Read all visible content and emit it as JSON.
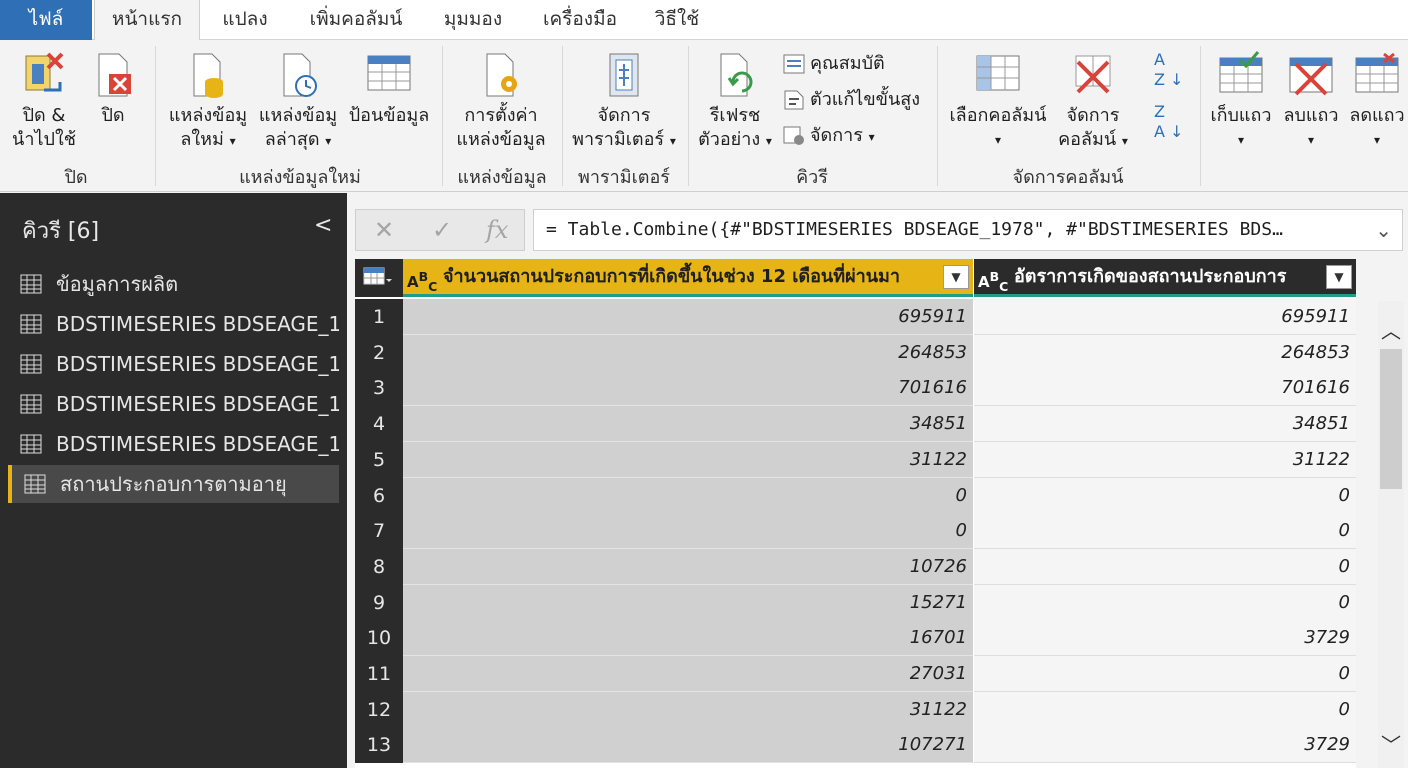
{
  "tabs": [
    "ไฟล์",
    "หน้าแรก",
    "แปลง",
    "เพิ่มคอลัมน์",
    "มุมมอง",
    "เครื่องมือ",
    "วิธีใช้"
  ],
  "ribbon": {
    "close_apply_1": "ปิด &",
    "close_apply_2": "นำไปใช้",
    "close": "ปิด",
    "group_close": "ปิด",
    "new_source_1": "แหล่งข้อมู",
    "new_source_2": "ลใหม่",
    "recent_source_1": "แหล่งข้อมู",
    "recent_source_2": "ลล่าสุด",
    "enter_data": "ป้อนข้อมูล",
    "group_new_query": "แหล่งข้อมูลใหม่",
    "source_settings_1": "การตั้งค่า",
    "source_settings_2": "แหล่งข้อมูล",
    "group_source": "แหล่งข้อมูล",
    "manage_params_1": "จัดการ",
    "manage_params_2": "พารามิเตอร์",
    "group_params": "พารามิเตอร์",
    "refresh_1": "รีเฟรช",
    "refresh_2": "ตัวอย่าง",
    "properties": "คุณสมบัติ",
    "advanced_editor": "ตัวแก้ไขขั้นสูง",
    "manage": "จัดการ",
    "group_query": "คิวรี",
    "choose_cols": "เลือกคอลัมน์",
    "remove_cols_1": "จัดการ",
    "remove_cols_2": "คอลัมน์",
    "group_manage_cols": "จัดการคอลัมน์",
    "keep_rows": "เก็บแถว",
    "remove_rows": "ลบแถว",
    "reduce_rows": "ลดแถว"
  },
  "queries": {
    "title": "คิวรี [6]",
    "items": [
      "ข้อมูลการผลิต",
      "BDSTIMESERIES BDSEAGE_1...",
      "BDSTIMESERIES BDSEAGE_1...",
      "BDSTIMESERIES BDSEAGE_1...",
      "BDSTIMESERIES BDSEAGE_1...",
      "สถานประกอบการตามอายุ"
    ]
  },
  "formula": "= Table.Combine({#\"BDSTIMESERIES BDSEAGE_1978\", #\"BDSTIMESERIES BDS…",
  "columns": [
    "จำนวนสถานประกอบการที่เกิดขึ้นในช่วง 12 เดือนที่ผ่านมา",
    "อัตราการเกิดของสถานประกอบการ"
  ],
  "rows": [
    {
      "n": "1",
      "a": "695911",
      "b": "695911"
    },
    {
      "n": "2",
      "a": "264853",
      "b": "264853"
    },
    {
      "n": "3",
      "a": "701616",
      "b": "701616"
    },
    {
      "n": "4",
      "a": "34851",
      "b": "34851"
    },
    {
      "n": "5",
      "a": "31122",
      "b": "31122"
    },
    {
      "n": "6",
      "a": "0",
      "b": "0"
    },
    {
      "n": "7",
      "a": "0",
      "b": "0"
    },
    {
      "n": "8",
      "a": "10726",
      "b": "0"
    },
    {
      "n": "9",
      "a": "15271",
      "b": "0"
    },
    {
      "n": "10",
      "a": "16701",
      "b": "3729"
    },
    {
      "n": "11",
      "a": "27031",
      "b": "0"
    },
    {
      "n": "12",
      "a": "31122",
      "b": "0"
    },
    {
      "n": "13",
      "a": "107271",
      "b": "3729"
    }
  ],
  "colors": {
    "file_tab": "#2f6fb5",
    "selected_column": "#e7b416",
    "accent_teal": "#1f9c8e",
    "pane_dark": "#2b2b2b"
  }
}
